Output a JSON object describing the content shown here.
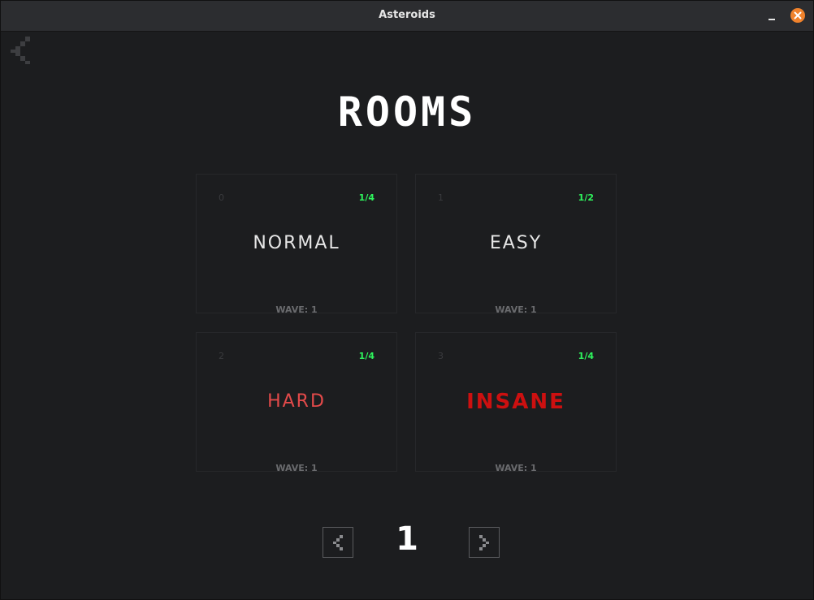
{
  "window": {
    "title": "Asteroids"
  },
  "heading": "ROOMS",
  "rooms": [
    {
      "index": "0",
      "players": "1/4",
      "mode": "NORMAL",
      "mode_color": "#e6e6e6",
      "wave": "WAVE: 1"
    },
    {
      "index": "1",
      "players": "1/2",
      "mode": "EASY",
      "mode_color": "#e6e6e6",
      "wave": "WAVE: 1"
    },
    {
      "index": "2",
      "players": "1/4",
      "mode": "HARD",
      "mode_color": "#e34a4a",
      "wave": "WAVE: 1"
    },
    {
      "index": "3",
      "players": "1/4",
      "mode": "INSANE",
      "mode_color": "#cc1010",
      "wave": "WAVE: 1"
    }
  ],
  "pagination": {
    "current_page": "1"
  },
  "icons": {
    "back": "chevron-left-icon",
    "prev": "chevron-left-icon",
    "next": "chevron-right-icon",
    "minimize": "minimize-icon",
    "close": "close-icon"
  },
  "colors": {
    "background": "#1c1d1f",
    "players_green": "#2ef55d",
    "close_orange": "#f0822c"
  }
}
